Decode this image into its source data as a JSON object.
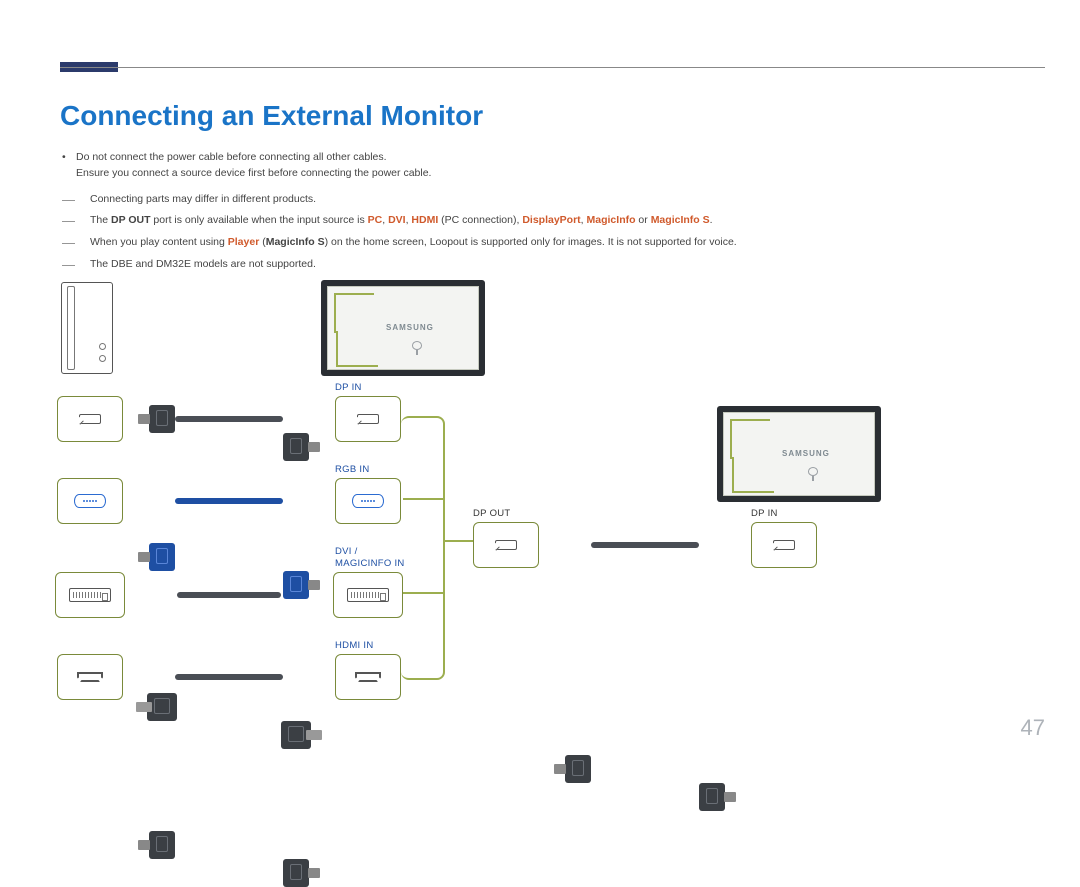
{
  "page": {
    "title": "Connecting an External Monitor",
    "page_number": "47"
  },
  "bullets": {
    "b1": "Do not connect the power cable before connecting all other cables.",
    "b1b": "Ensure you connect a source device first before connecting the power cable."
  },
  "notes": {
    "n1": "Connecting parts may differ in different products.",
    "n2_pre": "The ",
    "n2_dpout": "DP OUT",
    "n2_mid": " port is only available when the input source is ",
    "n2_pc": "PC",
    "n2_sep1": ", ",
    "n2_dvi": "DVI",
    "n2_sep2": ", ",
    "n2_hdmi": "HDMI",
    "n2_paren": " (PC connection), ",
    "n2_dp": "DisplayPort",
    "n2_sep3": ", ",
    "n2_mi": "MagicInfo",
    "n2_or": " or ",
    "n2_mis": "MagicInfo S",
    "n2_end": ".",
    "n3_pre": "When you play content using ",
    "n3_player": "Player",
    "n3_paren_open": " (",
    "n3_mis": "MagicInfo S",
    "n3_end": ") on the home screen, Loopout is supported only for images. It is not supported for voice.",
    "n4": "The DBE and DM32E models are not supported."
  },
  "labels": {
    "dp_in": "DP IN",
    "rgb_in": "RGB IN",
    "dvi_magicinfo_in": "DVI / MAGICINFO IN",
    "hdmi_in": "HDMI IN",
    "dp_out": "DP OUT",
    "dp_in_2": "DP IN",
    "monitor_logo": "SAMSUNG"
  }
}
